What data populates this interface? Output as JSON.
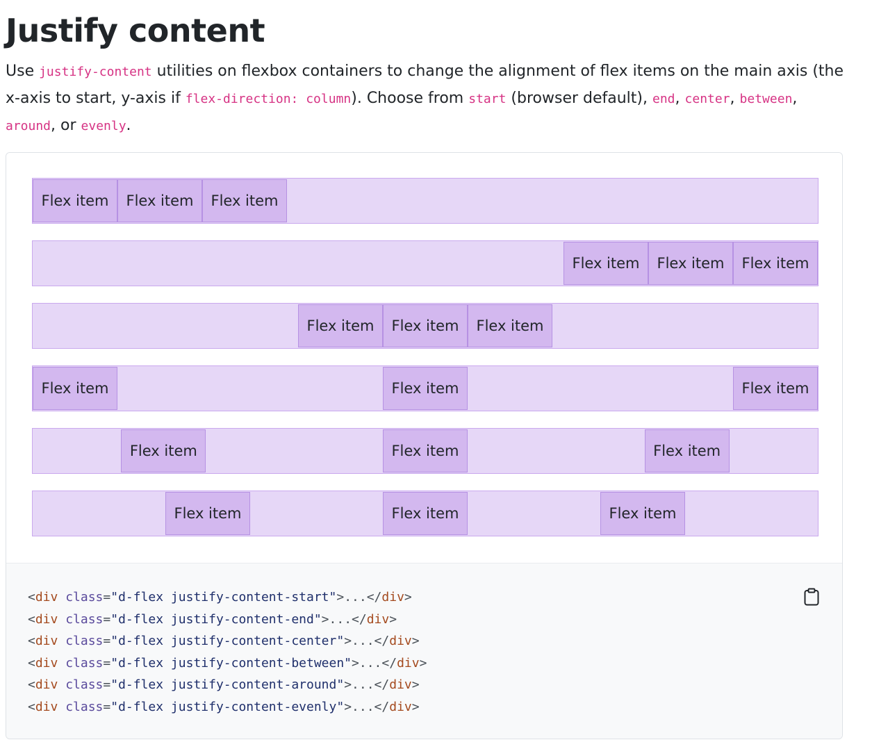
{
  "page": {
    "title": "Justify content",
    "intro": {
      "t1": "Use ",
      "c1": "justify-content",
      "t2": " utilities on flexbox containers to change the alignment of flex items on the main axis (the x-axis to start, y-axis if ",
      "c2": "flex-direction: column",
      "t3": "). Choose from ",
      "c3": "start",
      "t4": " (browser default), ",
      "c4": "end",
      "t5": ", ",
      "c5": "center",
      "t6": ", ",
      "c6": "between",
      "t7": ", ",
      "c7": "around",
      "t8": ", or ",
      "c8": "evenly",
      "t9": "."
    }
  },
  "demo": {
    "rows": [
      {
        "mode": "start",
        "items": [
          "Flex item",
          "Flex item",
          "Flex item"
        ]
      },
      {
        "mode": "end",
        "items": [
          "Flex item",
          "Flex item",
          "Flex item"
        ]
      },
      {
        "mode": "center",
        "items": [
          "Flex item",
          "Flex item",
          "Flex item"
        ]
      },
      {
        "mode": "between",
        "items": [
          "Flex item",
          "Flex item",
          "Flex item"
        ]
      },
      {
        "mode": "around",
        "items": [
          "Flex item",
          "Flex item",
          "Flex item"
        ]
      },
      {
        "mode": "evenly",
        "items": [
          "Flex item",
          "Flex item",
          "Flex item"
        ]
      }
    ]
  },
  "code": {
    "lines": [
      {
        "open": "<",
        "tag": "div",
        "attr": "class",
        "eq": "=",
        "value": "\"d-flex justify-content-start\"",
        "close": ">",
        "ellipsis": "...",
        "end_open": "</",
        "end_tag": "div",
        "end_close": ">"
      },
      {
        "open": "<",
        "tag": "div",
        "attr": "class",
        "eq": "=",
        "value": "\"d-flex justify-content-end\"",
        "close": ">",
        "ellipsis": "...",
        "end_open": "</",
        "end_tag": "div",
        "end_close": ">"
      },
      {
        "open": "<",
        "tag": "div",
        "attr": "class",
        "eq": "=",
        "value": "\"d-flex justify-content-center\"",
        "close": ">",
        "ellipsis": "...",
        "end_open": "</",
        "end_tag": "div",
        "end_close": ">"
      },
      {
        "open": "<",
        "tag": "div",
        "attr": "class",
        "eq": "=",
        "value": "\"d-flex justify-content-between\"",
        "close": ">",
        "ellipsis": "...",
        "end_open": "</",
        "end_tag": "div",
        "end_close": ">"
      },
      {
        "open": "<",
        "tag": "div",
        "attr": "class",
        "eq": "=",
        "value": "\"d-flex justify-content-around\"",
        "close": ">",
        "ellipsis": "...",
        "end_open": "</",
        "end_tag": "div",
        "end_close": ">"
      },
      {
        "open": "<",
        "tag": "div",
        "attr": "class",
        "eq": "=",
        "value": "\"d-flex justify-content-evenly\"",
        "close": ">",
        "ellipsis": "...",
        "end_open": "</",
        "end_tag": "div",
        "end_close": ">"
      }
    ],
    "copy_icon": "clipboard-icon"
  },
  "colors": {
    "code_pink": "#d63384",
    "row_background": "#e6d7f7",
    "item_background": "#d3b8ef",
    "item_border": "#b691e3"
  }
}
